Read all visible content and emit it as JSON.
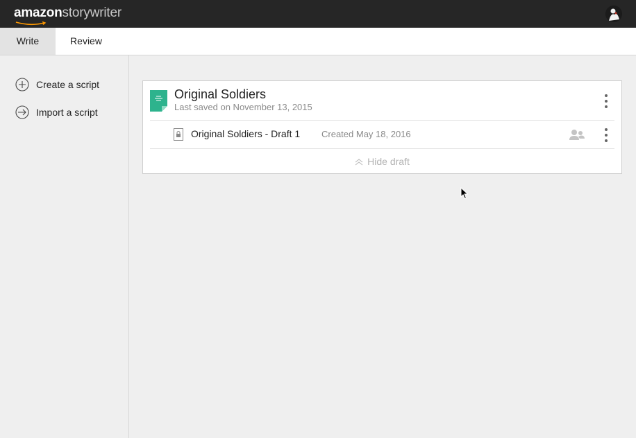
{
  "header": {
    "logo_brand": "amazon",
    "logo_product": "storywriter"
  },
  "tabs": [
    {
      "label": "Write",
      "active": true
    },
    {
      "label": "Review",
      "active": false
    }
  ],
  "sidebar": {
    "items": [
      {
        "label": "Create a script",
        "icon": "plus-circle-icon"
      },
      {
        "label": "Import a script",
        "icon": "import-arrow-icon"
      }
    ]
  },
  "script": {
    "title": "Original Soldiers",
    "meta": "Last saved on November 13, 2015",
    "icon_color": "#2db38d",
    "draft": {
      "title": "Original Soldiers - Draft 1",
      "created": "Created May 18, 2016"
    },
    "hide_draft_label": "Hide draft"
  }
}
